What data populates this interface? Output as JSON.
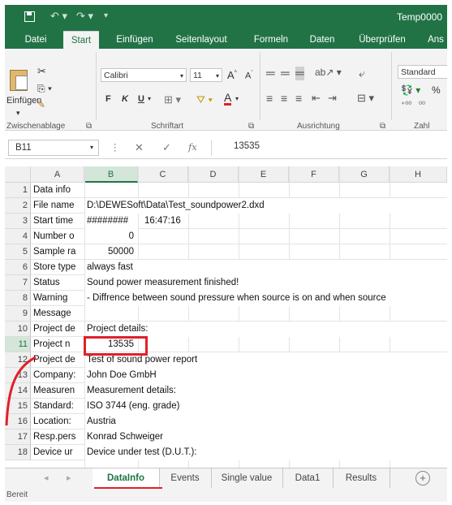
{
  "window": {
    "title": "Temp0000"
  },
  "ribbon_tabs": [
    "Datei",
    "Start",
    "Einfügen",
    "Seitenlayout",
    "Formeln",
    "Daten",
    "Überprüfen",
    "Ans"
  ],
  "active_tab": "Start",
  "clipboard": {
    "paste_label": "Einfügen",
    "group_label": "Zwischenablage"
  },
  "font": {
    "name": "Calibri",
    "size": "11",
    "bold": "F",
    "italic": "K",
    "underline": "U",
    "group_label": "Schriftart"
  },
  "alignment": {
    "group_label": "Ausrichtung"
  },
  "number": {
    "format": "Standard",
    "percent": "%",
    "group_label": "Zahl"
  },
  "formula_bar": {
    "name_box": "B11",
    "fx": "fx",
    "value": "13535"
  },
  "columns": [
    "A",
    "B",
    "C",
    "D",
    "E",
    "F",
    "G",
    "H"
  ],
  "selected_column": "B",
  "selected_row": "11",
  "rows": [
    {
      "n": "1",
      "a": "Data info",
      "b": ""
    },
    {
      "n": "2",
      "a": "File name",
      "b": "D:\\DEWESoft\\Data\\Test_soundpower2.dxd"
    },
    {
      "n": "3",
      "a": "Start time",
      "b": "########",
      "c": "16:47:16"
    },
    {
      "n": "4",
      "a": "Number o",
      "b_num": "0"
    },
    {
      "n": "5",
      "a": "Sample ra",
      "b_num": "50000"
    },
    {
      "n": "6",
      "a": "Store type",
      "b": "always fast"
    },
    {
      "n": "7",
      "a": "Status",
      "b": "Sound power measurement finished!"
    },
    {
      "n": "8",
      "a": "Warning",
      "b": "- Diffrence between sound pressure when source is on and when source"
    },
    {
      "n": "9",
      "a": "Message",
      "b": ""
    },
    {
      "n": "10",
      "a": "Project de",
      "b": "Project details:"
    },
    {
      "n": "11",
      "a": "Project n",
      "b_num": "13535"
    },
    {
      "n": "12",
      "a": "Project de",
      "b": "Test of sound power report"
    },
    {
      "n": "13",
      "a": "Company:",
      "b": "John Doe GmbH"
    },
    {
      "n": "14",
      "a": "Measuren",
      "b": "Measurement details:"
    },
    {
      "n": "15",
      "a": "Standard:",
      "b": "ISO 3744 (eng. grade)"
    },
    {
      "n": "16",
      "a": "Location:",
      "b": "Austria"
    },
    {
      "n": "17",
      "a": "Resp.pers",
      "b": "Konrad Schweiger"
    },
    {
      "n": "18",
      "a": "Device ur",
      "b": "Device under test (D.U.T.):"
    }
  ],
  "sheet_tabs": [
    "DataInfo",
    "Events",
    "Single value",
    "Data1",
    "Results"
  ],
  "active_sheet": "DataInfo",
  "add_sheet": "+",
  "status": "Bereit",
  "colors": {
    "excel_green": "#217346",
    "highlight_red": "#e0202a"
  }
}
